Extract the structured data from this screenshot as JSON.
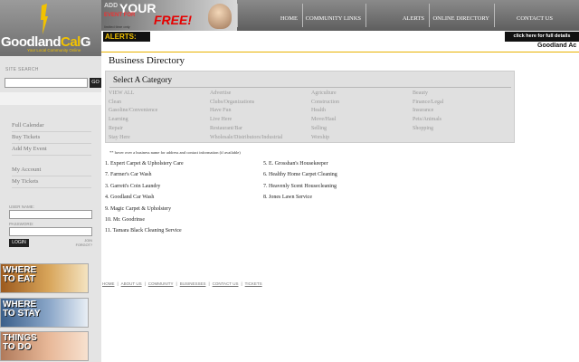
{
  "brand": {
    "name_a": "Goodland",
    "name_b": "Cal",
    "name_c": "G",
    "tagline": "Your Local Community Online"
  },
  "ad": {
    "line1": "ADD",
    "line2": "YOUR",
    "line3": "EVENT FOR",
    "line4": "FREE!",
    "note": "limited time only"
  },
  "nav": [
    "HOME",
    "COMMUNITY LINKS",
    "ALERTS",
    "ONLINE DIRECTORY",
    "CONTACT US"
  ],
  "alerts": {
    "label": "ALERTS:",
    "details": "click here for full details",
    "ticker": "Goodland Ac"
  },
  "sidebar": {
    "search_label": "SITE SEARCH",
    "go": "GO",
    "links_a": [
      "Full Calendar",
      "Buy Tickets",
      "Add My Event"
    ],
    "links_b": [
      "My Account",
      "My Tickets"
    ],
    "username_label": "USER NAME:",
    "password_label": "PASSWORD:",
    "login": "LOGIN",
    "join": "JOIN\nFORGOT?"
  },
  "promos": [
    "WHERE TO EAT",
    "WHERE TO STAY",
    "THINGS TO DO"
  ],
  "page_title": "Business Directory",
  "category_title": "Select A Category",
  "categories": [
    [
      "VIEW ALL",
      "Advertise",
      "Agriculture",
      "Beauty"
    ],
    [
      "Clean",
      "Clubs/Organizations",
      "Construction",
      "Finance/Legal"
    ],
    [
      "Gasoline/Convenience",
      "Have Fun",
      "Health",
      "Insurance"
    ],
    [
      "Learning",
      "Live Here",
      "Move/Haul",
      "Pets/Animals"
    ],
    [
      "Repair",
      "Restaurant/Bar",
      "Selling",
      "Shopping"
    ],
    [
      "Stay Here",
      "Wholesale/Distributors/Industrial",
      "Worship",
      ""
    ]
  ],
  "hover_note": "** hover over a business name for address and contact information (if available)",
  "businesses_left": [
    "1.  Expert Carpet & Upholstery Care",
    "7.  Farmer's Car Wash",
    "3.  Garrett's Coin Laundry",
    "4.  Goodland Car Wash",
    "9.  Magic Carpet & Upholstery",
    "10.  Mr. Goodrinse",
    "11.  Tamara Black Cleaning Service"
  ],
  "businesses_right": [
    "5. E. Grosshan's Housekeeper",
    "6.  Healthy Home Carpet Cleaning",
    "7.  Heavenly Scent Housecleaning",
    "8.  Jones Lawn Service"
  ],
  "footer": [
    "HOME",
    "ABOUT US",
    "COMMUNITY",
    "BUSINESSES",
    "CONTACT US",
    "TICKETS"
  ]
}
